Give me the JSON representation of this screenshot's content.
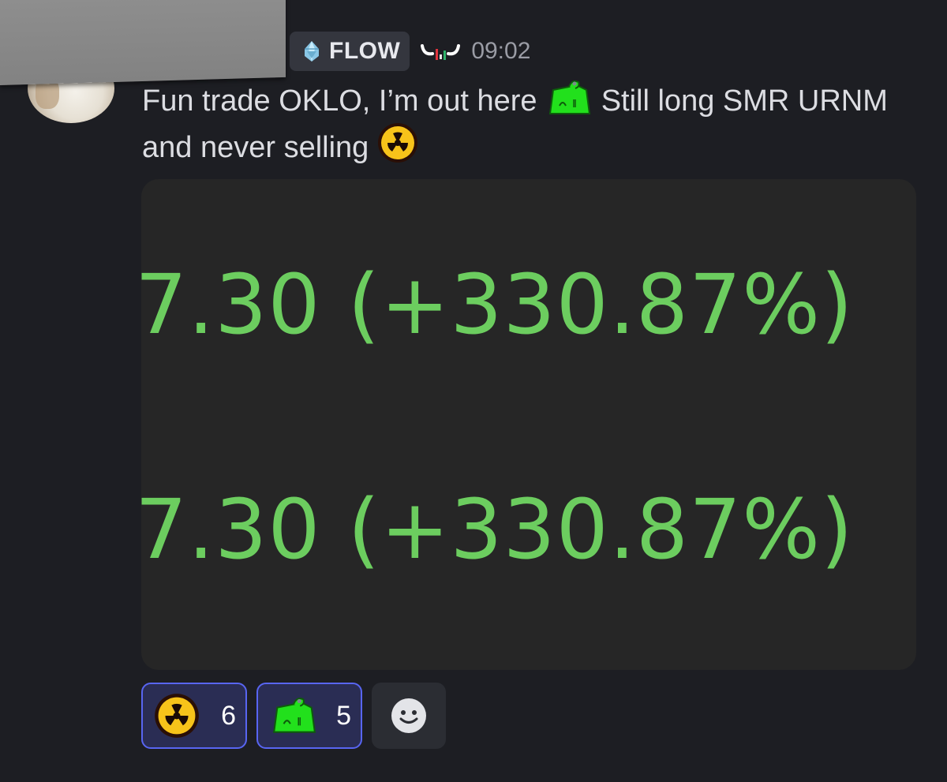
{
  "header": {
    "role_tag_label": "FLOW",
    "role_tag_icon": "diamond-icon",
    "badge_icon": "bull-horns-icon",
    "timestamp": "09:02"
  },
  "message": {
    "text_part_1": "Fun trade OKLO, I’m out here",
    "emoji_1": "green-bag-icon",
    "text_part_2": " Still long SMR URNM and never selling",
    "emoji_2": "radioactive-icon"
  },
  "embed": {
    "line_1": "7.30 (+330.87%)",
    "line_2": "7.30 (+330.87%)",
    "text_color": "#6ccd5f"
  },
  "reactions": [
    {
      "icon": "radioactive-icon",
      "count": "6"
    },
    {
      "icon": "green-bag-icon",
      "count": "5"
    }
  ],
  "add_reaction_icon": "smiley-icon",
  "colors": {
    "background": "#1d1e23",
    "embed_bg": "#262626",
    "reaction_active_border": "#5865f2",
    "reaction_active_bg": "#2a2d54"
  }
}
